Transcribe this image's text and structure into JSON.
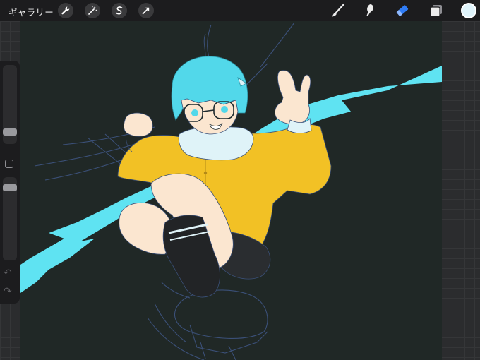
{
  "toolbar": {
    "gallery_label": "ギャラリー",
    "left_tools": [
      {
        "name": "wrench-icon"
      },
      {
        "name": "magic-wand-icon"
      },
      {
        "name": "selection-s-icon"
      },
      {
        "name": "transform-arrow-icon"
      }
    ],
    "right_tools": [
      {
        "name": "brush-icon",
        "active": false
      },
      {
        "name": "smudge-icon",
        "active": false
      },
      {
        "name": "eraser-icon",
        "active": true
      },
      {
        "name": "layers-icon",
        "active": false
      }
    ],
    "current_color": "#dff4fb",
    "active_tool_color": "#2f7cf6"
  },
  "sidebar": {
    "brush_size_slider": "brush-size-slider",
    "opacity_slider": "opacity-slider",
    "modifier_button": "modifier-button",
    "undo_icon": "undo-icon",
    "redo_icon": "redo-icon"
  },
  "artwork": {
    "subject": "illustration",
    "colors": {
      "background": "#202826",
      "lightning": "#5fe3f2",
      "hair": "#52d8ea",
      "jacket": "#f2c125",
      "skin": "#fbe6d0",
      "scarf": "#dff3f8",
      "shorts": "#2a2d30",
      "socks": "#222426",
      "sketch_lines": "#3b5078"
    }
  }
}
